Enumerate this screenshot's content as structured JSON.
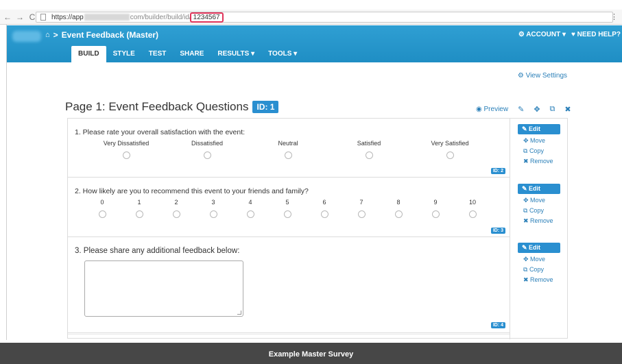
{
  "browser": {
    "back": "←",
    "forward": "→",
    "reload": "C",
    "url_host": "https://app",
    "url_path": "com/builder/build/id/",
    "url_id": "1234567",
    "menu": "⋮"
  },
  "header": {
    "home_icon": "home-icon",
    "crumb_sep": ">",
    "title": "Event Feedback (Master)",
    "account": "ACCOUNT ▾",
    "help": "NEED HELP?"
  },
  "tabs": [
    {
      "label": "BUILD"
    },
    {
      "label": "STYLE"
    },
    {
      "label": "TEST"
    },
    {
      "label": "SHARE"
    },
    {
      "label": "RESULTS ▾"
    },
    {
      "label": "TOOLS ▾"
    }
  ],
  "view_settings": "View Settings",
  "page": {
    "title": "Page 1: Event Feedback Questions",
    "id": "ID: 1",
    "preview": "Preview"
  },
  "questions": [
    {
      "title": "1. Please rate your overall satisfaction with the event:",
      "id": "ID: 2",
      "options": [
        "Very Dissatisfied",
        "Dissatisfied",
        "Neutral",
        "Satisfied",
        "Very Satisfied"
      ]
    },
    {
      "title": "2. How likely are you to recommend this event to your friends and family?",
      "id": "ID: 3",
      "options": [
        "0",
        "1",
        "2",
        "3",
        "4",
        "5",
        "6",
        "7",
        "8",
        "9",
        "10"
      ]
    },
    {
      "title": "3. Please share any additional feedback below:",
      "id": "ID: 4"
    }
  ],
  "actions": {
    "edit": "Edit",
    "move": "Move",
    "copy": "Copy",
    "remove": "Remove"
  },
  "footer": "Example Master Survey"
}
